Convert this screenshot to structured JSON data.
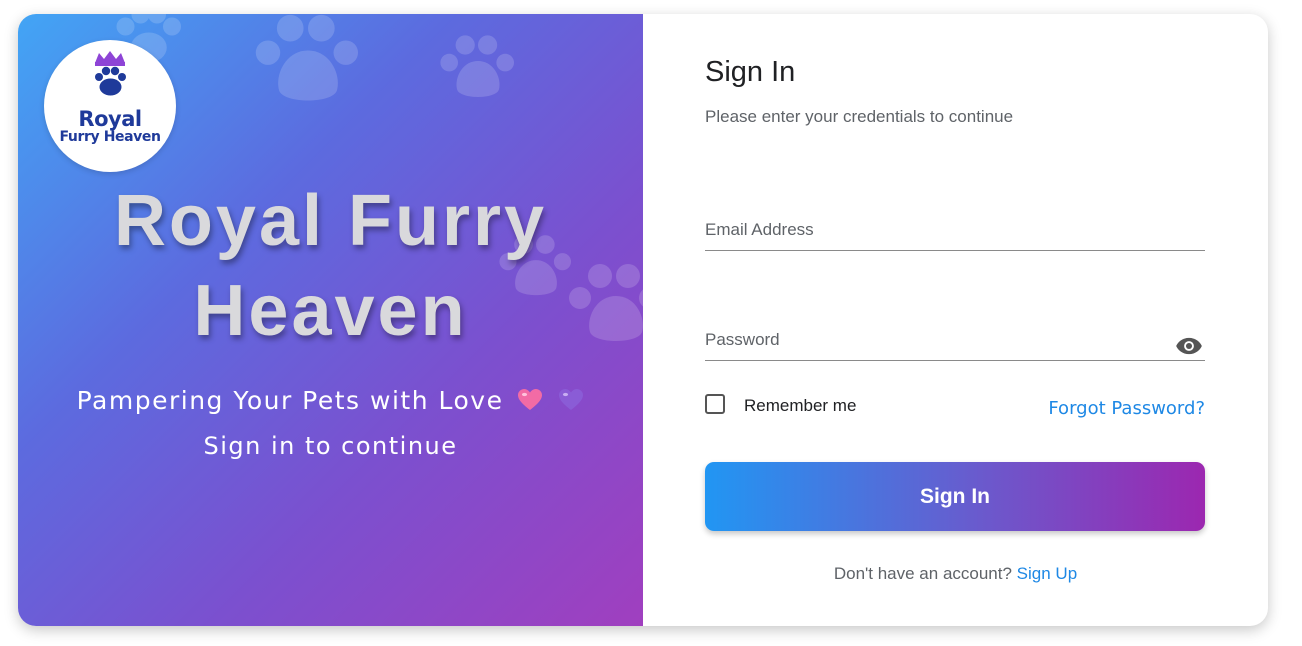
{
  "left_panel": {
    "logo": {
      "line1": "Royal",
      "line2": "Furry Heaven"
    },
    "brand_line1": "Royal Furry",
    "brand_line2": "Heaven",
    "tagline": "Pampering Your Pets with Love",
    "subtitle": "Sign in to continue"
  },
  "form": {
    "title": "Sign In",
    "description": "Please enter your credentials to continue",
    "email_label": "Email Address",
    "password_label": "Password",
    "remember_label": "Remember me",
    "forgot_label": "Forgot Password?",
    "submit_label": "Sign In",
    "signup_prompt": "Don't have an account?",
    "signup_link": "Sign Up"
  },
  "colors": {
    "accent": "#1e88e5",
    "button_start": "#2196f3",
    "button_end": "#9c27b0",
    "panel_start": "#42a5f5",
    "panel_end": "#a03fbf"
  },
  "icons": [
    "paw-icon",
    "crown-icon",
    "pink-heart-icon",
    "purple-heart-icon",
    "eye-icon"
  ]
}
